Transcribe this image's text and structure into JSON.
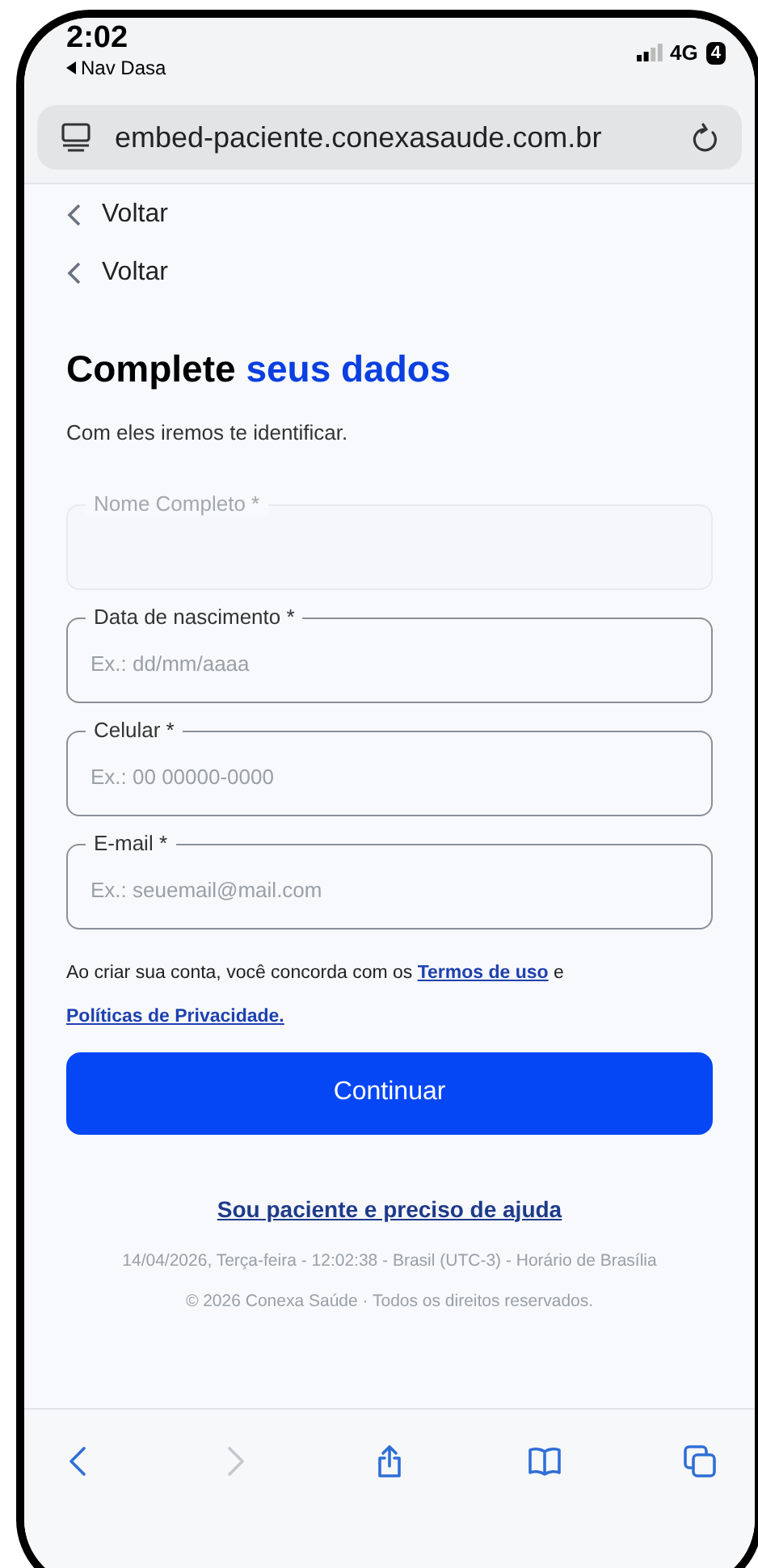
{
  "status_bar": {
    "time": "2:02",
    "back_app": "Nav Dasa",
    "network": "4G",
    "battery": "4"
  },
  "browser": {
    "url": "embed-paciente.conexasaude.com.br"
  },
  "back_links": [
    "Voltar",
    "Voltar"
  ],
  "heading": {
    "text": "Complete",
    "highlight": "seus dados"
  },
  "subtitle": "Com eles iremos te identificar.",
  "fields": [
    {
      "label": "Nome Completo *",
      "disabled": true
    },
    {
      "label": "Data de nascimento *",
      "placeholder": "Ex.: dd/mm/aaaa",
      "disabled": false
    },
    {
      "label": "Celular *",
      "placeholder": "Ex.: 00 00000-0000",
      "disabled": false
    },
    {
      "label": "E-mail *",
      "placeholder": "Ex.: seuemail@mail.com",
      "disabled": false
    }
  ],
  "terms": {
    "before": "Ao criar sua conta, você concorda com os",
    "link_terms": "Termos de uso",
    "middle": "e",
    "link_privacy": "Políticas de Privacidade."
  },
  "button": "Continuar",
  "help_link": "Sou paciente e preciso de ajuda",
  "timestamp": "14/04/2026, Terça-feira - 12:02:38 - Brasil (UTC-3) - Horário de Brasília",
  "copyright": "© 2026 Conexa Saúde · Todos os direitos reservados.",
  "toolbar": [
    {
      "kind": "back",
      "disabled": false
    },
    {
      "kind": "forward",
      "disabled": true
    },
    {
      "kind": "share",
      "disabled": false
    },
    {
      "kind": "bookmarks",
      "disabled": false
    },
    {
      "kind": "tabs",
      "disabled": false
    }
  ]
}
